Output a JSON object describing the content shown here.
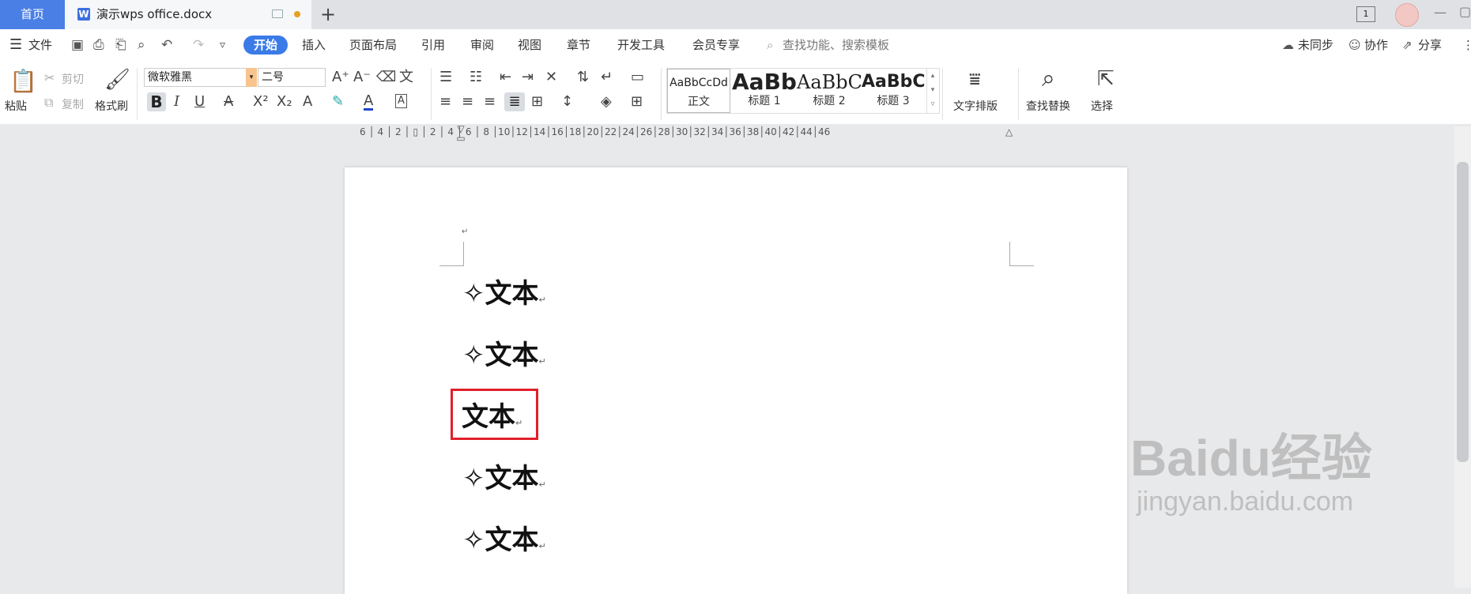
{
  "tabs": {
    "home": "首页",
    "doc_icon": "W",
    "doc_title": "演示wps office.docx",
    "plus": "+"
  },
  "window": {
    "page_count": "1",
    "min": "—",
    "max": "▢"
  },
  "menu": {
    "file": "文件",
    "start": "开始",
    "insert": "插入",
    "layout": "页面布局",
    "reference": "引用",
    "review": "审阅",
    "view": "视图",
    "chapter": "章节",
    "devtools": "开发工具",
    "vip": "会员专享",
    "search_placeholder": "查找功能、搜索模板",
    "sync": "未同步",
    "collab": "协作",
    "share": "分享",
    "more": "⋮"
  },
  "ribbon": {
    "paste": "粘贴",
    "cut": "剪切",
    "copy": "复制",
    "format_painter": "格式刷",
    "font_name": "微软雅黑",
    "font_size": "二号",
    "bold": "B",
    "italic": "I",
    "underline": "U",
    "styles": [
      {
        "preview": "AaBbCcDd",
        "name": "正文"
      },
      {
        "preview": "AaBb",
        "name": "标题 1"
      },
      {
        "preview": "AaBbC",
        "name": "标题 2"
      },
      {
        "preview": "AaBbC",
        "name": "标题 3"
      }
    ],
    "text_layout": "文字排版",
    "find_replace": "查找替换",
    "select": "选择"
  },
  "ruler_numbers": "6 │ 4 │ 2 │ ▯ │ 2 │ 4 │ 6 │ 8 │10│12│14│16│18│20│22│24│26│28│30│32│34│36│38│40│42│44│46",
  "document": {
    "lines": [
      {
        "bullet": "✧",
        "text": "文本"
      },
      {
        "bullet": "✧",
        "text": "文本"
      },
      {
        "bullet": "",
        "text": "文本"
      },
      {
        "bullet": "✧",
        "text": "文本"
      },
      {
        "bullet": "✧",
        "text": "文本"
      }
    ],
    "para_mark": "↵"
  },
  "watermark": {
    "brand": "Baidu经验",
    "url": "jingyan.baidu.com"
  },
  "colors": {
    "accent": "#3b7be8",
    "highlight_box": "#e0202a",
    "home_tab": "#4a7fe6"
  }
}
